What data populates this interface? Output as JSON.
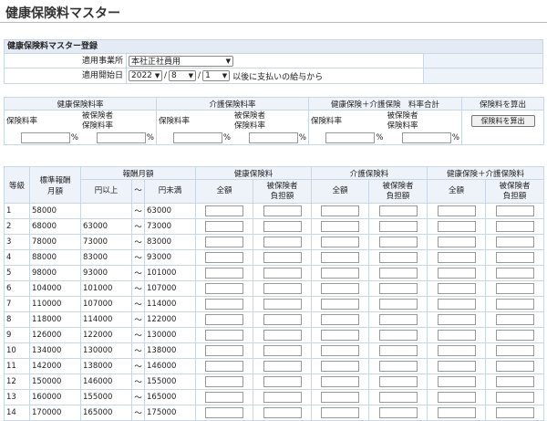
{
  "page_title": "健康保険料マスター",
  "form": {
    "title": "健康保険料マスター登録",
    "office_label": "適用事業所",
    "office_value": "本社正社員用",
    "start_label": "適用開始日",
    "year_value": "2022",
    "month_value": "8",
    "day_value": "1",
    "date_sep": "/",
    "start_note": "以後に支払いの給与から"
  },
  "rates": {
    "health_header": "健康保険料率",
    "care_header": "介護保険料率",
    "total_header": "健康保険＋介護保険　料率合計",
    "calc_header": "保険料を算出",
    "rate_label": "保険料率",
    "insured_label_1": "被保険者",
    "insured_label_2": "保険料率",
    "percent": "%",
    "calc_button": "保険料を算出"
  },
  "table": {
    "grade": "等級",
    "standard_1": "標準報酬",
    "standard_2": "月額",
    "remuneration": "報酬月額",
    "min": "円以上",
    "tilde": "～",
    "max": "円未満",
    "health": "健康保険料",
    "care": "介護保険料",
    "combined": "健康保険＋介護保険料",
    "total": "全額",
    "insured_1": "被保険者",
    "insured_2": "負担額"
  },
  "rows": [
    {
      "grade": "1",
      "standard": "58000",
      "min": "",
      "max": "63000"
    },
    {
      "grade": "2",
      "standard": "68000",
      "min": "63000",
      "max": "73000"
    },
    {
      "grade": "3",
      "standard": "78000",
      "min": "73000",
      "max": "83000"
    },
    {
      "grade": "4",
      "standard": "88000",
      "min": "83000",
      "max": "93000"
    },
    {
      "grade": "5",
      "standard": "98000",
      "min": "93000",
      "max": "101000"
    },
    {
      "grade": "6",
      "standard": "104000",
      "min": "101000",
      "max": "107000"
    },
    {
      "grade": "7",
      "standard": "110000",
      "min": "107000",
      "max": "114000"
    },
    {
      "grade": "8",
      "standard": "118000",
      "min": "114000",
      "max": "122000"
    },
    {
      "grade": "9",
      "standard": "126000",
      "min": "122000",
      "max": "130000"
    },
    {
      "grade": "10",
      "standard": "134000",
      "min": "130000",
      "max": "138000"
    },
    {
      "grade": "11",
      "standard": "142000",
      "min": "138000",
      "max": "146000"
    },
    {
      "grade": "12",
      "standard": "150000",
      "min": "146000",
      "max": "155000"
    },
    {
      "grade": "13",
      "standard": "160000",
      "min": "155000",
      "max": "165000"
    },
    {
      "grade": "14",
      "standard": "170000",
      "min": "165000",
      "max": "175000"
    }
  ]
}
